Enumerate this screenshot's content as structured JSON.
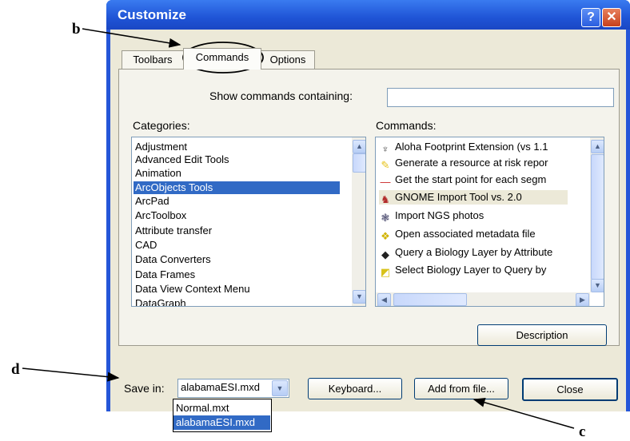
{
  "annotations": {
    "b": "b",
    "d": "d",
    "c": "c"
  },
  "window": {
    "title": "Customize",
    "help_glyph": "?",
    "close_glyph": "✕"
  },
  "tabs": [
    {
      "label": "Toolbars"
    },
    {
      "label": "Commands",
      "active": true
    },
    {
      "label": "Options"
    }
  ],
  "search": {
    "label": "Show commands containing:",
    "value": ""
  },
  "categories": {
    "label": "Categories:",
    "items": [
      "Adjustment",
      "Advanced Edit Tools",
      "Animation",
      "ArcObjects Tools",
      "ArcPad",
      "ArcToolbox",
      "Attribute transfer",
      "CAD",
      "Data Converters",
      "Data Frames",
      "Data View Context Menu",
      "DataGraph"
    ],
    "selected": "ArcObjects Tools"
  },
  "commands": {
    "label": "Commands:",
    "items": [
      {
        "label": "Aloha Footprint Extension (vs 1.1",
        "icon": "figure-icon"
      },
      {
        "label": "Generate a resource at risk repor",
        "icon": "pencil-icon"
      },
      {
        "label": "Get the start point for each segm",
        "icon": "line-icon"
      },
      {
        "label": "GNOME Import Tool vs. 2.0",
        "icon": "gnome-icon"
      },
      {
        "label": "Import NGS photos",
        "icon": "photo-icon"
      },
      {
        "label": "Open associated metadata file",
        "icon": "metadata-icon"
      },
      {
        "label": "Query a Biology Layer by Attribute",
        "icon": "sql-fish-icon"
      },
      {
        "label": "Select Biology Layer to Query by",
        "icon": "select-layer-icon"
      }
    ]
  },
  "buttons": {
    "description": "Description",
    "keyboard": "Keyboard...",
    "add_from_file": "Add from file...",
    "close": "Close"
  },
  "save_in": {
    "label": "Save in:",
    "value": "alabamaESI.mxd",
    "options": [
      "Normal.mxt",
      "alabamaESI.mxd"
    ],
    "selected": "alabamaESI.mxd"
  },
  "colors": {
    "titlebar": "#2556d8",
    "selection": "#316ac5",
    "dialog_bg": "#ece9d8"
  }
}
